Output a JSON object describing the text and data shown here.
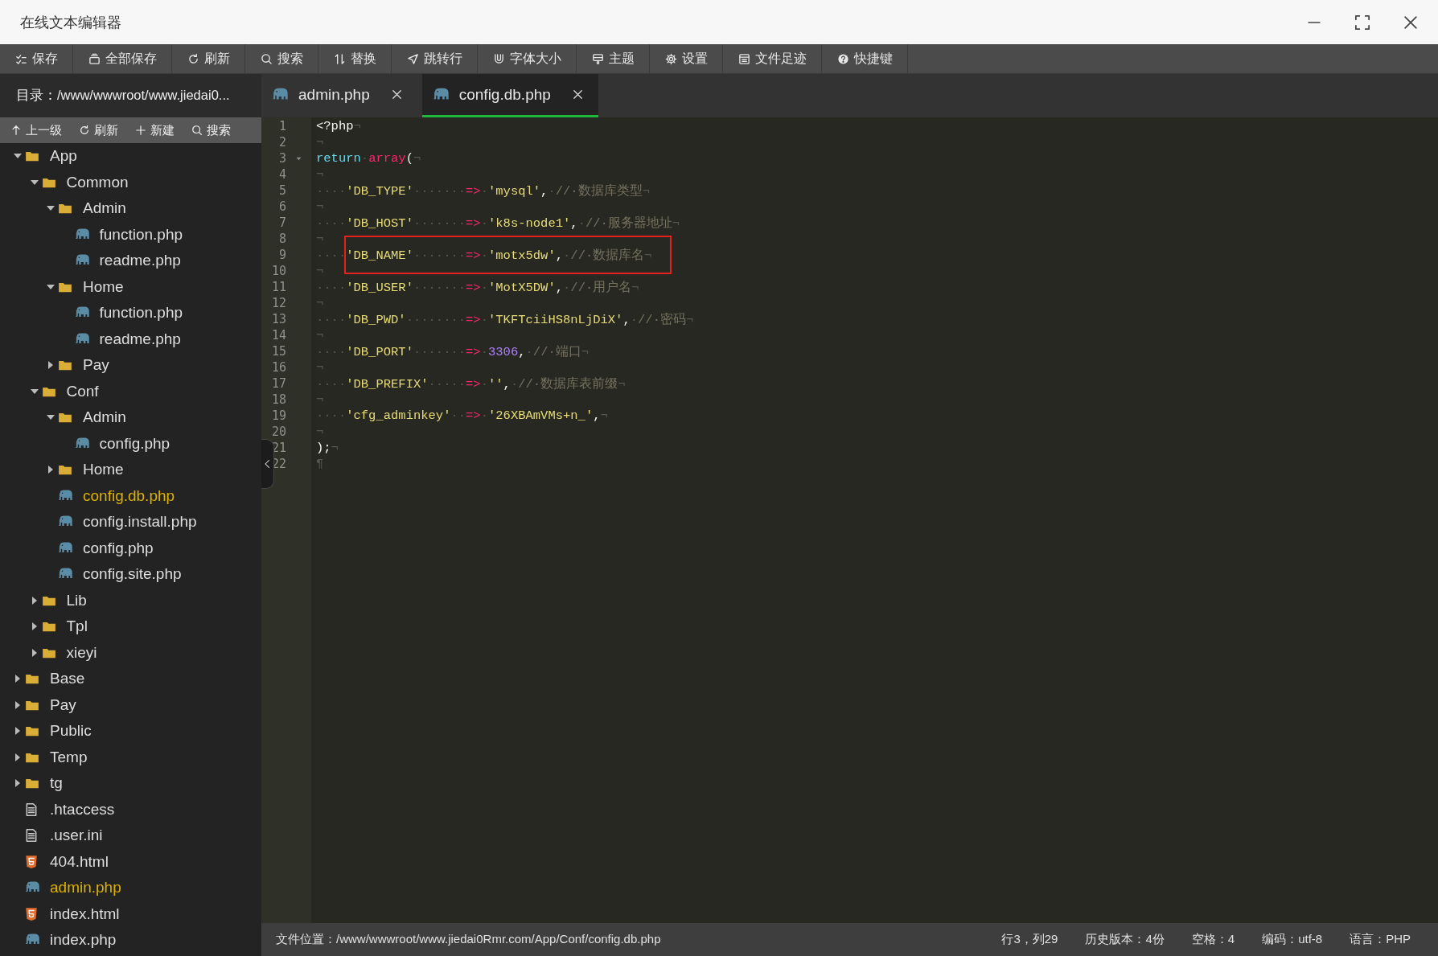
{
  "window": {
    "title": "在线文本编辑器"
  },
  "toolbar": [
    {
      "kind": "save",
      "label": "保存"
    },
    {
      "kind": "save-all",
      "label": "全部保存"
    },
    {
      "kind": "refresh",
      "label": "刷新"
    },
    {
      "kind": "search",
      "label": "搜索"
    },
    {
      "kind": "replace",
      "label": "替换"
    },
    {
      "kind": "goto",
      "label": "跳转行"
    },
    {
      "kind": "font",
      "label": "字体大小"
    },
    {
      "kind": "theme",
      "label": "主题"
    },
    {
      "kind": "settings",
      "label": "设置"
    },
    {
      "kind": "history",
      "label": "文件足迹"
    },
    {
      "kind": "shortcuts",
      "label": "快捷键"
    }
  ],
  "sidebar": {
    "directory": "目录：/www/wwwroot/www.jiedai0...",
    "actions": [
      {
        "kind": "up",
        "label": "上一级"
      },
      {
        "kind": "refresh",
        "label": "刷新"
      },
      {
        "kind": "new",
        "label": "新建"
      },
      {
        "kind": "search",
        "label": "搜索"
      }
    ],
    "tree": [
      {
        "name": "App",
        "kind": "folder",
        "expanded": true,
        "children": [
          {
            "name": "Common",
            "kind": "folder",
            "expanded": true,
            "children": [
              {
                "name": "Admin",
                "kind": "folder",
                "expanded": true,
                "children": [
                  {
                    "name": "function.php",
                    "kind": "php",
                    "open": false
                  },
                  {
                    "name": "readme.php",
                    "kind": "php",
                    "open": false
                  }
                ]
              },
              {
                "name": "Home",
                "kind": "folder",
                "expanded": true,
                "children": [
                  {
                    "name": "function.php",
                    "kind": "php",
                    "open": false
                  },
                  {
                    "name": "readme.php",
                    "kind": "php",
                    "open": false
                  }
                ]
              },
              {
                "name": "Pay",
                "kind": "folder",
                "expanded": false
              }
            ]
          },
          {
            "name": "Conf",
            "kind": "folder",
            "expanded": true,
            "children": [
              {
                "name": "Admin",
                "kind": "folder",
                "expanded": true,
                "children": [
                  {
                    "name": "config.php",
                    "kind": "php",
                    "open": false
                  }
                ]
              },
              {
                "name": "Home",
                "kind": "folder",
                "expanded": false
              },
              {
                "name": "config.db.php",
                "kind": "php",
                "open": true
              },
              {
                "name": "config.install.php",
                "kind": "php",
                "open": false
              },
              {
                "name": "config.php",
                "kind": "php",
                "open": false
              },
              {
                "name": "config.site.php",
                "kind": "php",
                "open": false
              }
            ]
          },
          {
            "name": "Lib",
            "kind": "folder",
            "expanded": false
          },
          {
            "name": "Tpl",
            "kind": "folder",
            "expanded": false
          },
          {
            "name": "xieyi",
            "kind": "folder",
            "expanded": false
          }
        ]
      },
      {
        "name": "Base",
        "kind": "folder",
        "expanded": false
      },
      {
        "name": "Pay",
        "kind": "folder",
        "expanded": false
      },
      {
        "name": "Public",
        "kind": "folder",
        "expanded": false
      },
      {
        "name": "Temp",
        "kind": "folder",
        "expanded": false
      },
      {
        "name": "tg",
        "kind": "folder",
        "expanded": false
      },
      {
        "name": ".htaccess",
        "kind": "text",
        "open": false
      },
      {
        "name": ".user.ini",
        "kind": "text",
        "open": false
      },
      {
        "name": "404.html",
        "kind": "html",
        "open": false
      },
      {
        "name": "admin.php",
        "kind": "php",
        "open": true
      },
      {
        "name": "index.html",
        "kind": "html",
        "open": false
      },
      {
        "name": "index.php",
        "kind": "php",
        "open": false
      }
    ]
  },
  "tabs": [
    {
      "label": "admin.php",
      "selected": false
    },
    {
      "label": "config.db.php",
      "selected": true
    }
  ],
  "editor": {
    "lines": [
      {
        "number": "1",
        "foldable": false,
        "boxed": false,
        "tokens": [
          {
            "kind": "plain",
            "text": "<?php"
          },
          {
            "kind": "ws",
            "text": "¬"
          }
        ]
      },
      {
        "number": "2",
        "foldable": false,
        "boxed": false,
        "tokens": [
          {
            "kind": "ws",
            "text": "¬"
          }
        ]
      },
      {
        "number": "3",
        "foldable": true,
        "boxed": false,
        "tokens": [
          {
            "kind": "kw",
            "text": "return"
          },
          {
            "kind": "ws",
            "text": "·"
          },
          {
            "kind": "fn",
            "text": "array"
          },
          {
            "kind": "plain",
            "text": "("
          },
          {
            "kind": "ws",
            "text": "¬"
          }
        ]
      },
      {
        "number": "4",
        "foldable": false,
        "boxed": false,
        "tokens": [
          {
            "kind": "ws",
            "text": "¬"
          }
        ]
      },
      {
        "number": "5",
        "foldable": false,
        "boxed": false,
        "tokens": [
          {
            "kind": "ws",
            "text": "····"
          },
          {
            "kind": "str",
            "text": "'DB_TYPE'"
          },
          {
            "kind": "ws",
            "text": "·······"
          },
          {
            "kind": "op",
            "text": "=>"
          },
          {
            "kind": "ws",
            "text": "·"
          },
          {
            "kind": "str",
            "text": "'mysql'"
          },
          {
            "kind": "plain",
            "text": ","
          },
          {
            "kind": "ws",
            "text": "·"
          },
          {
            "kind": "com",
            "text": "//·数据库类型"
          },
          {
            "kind": "ws",
            "text": "¬"
          }
        ]
      },
      {
        "number": "6",
        "foldable": false,
        "boxed": false,
        "tokens": [
          {
            "kind": "ws",
            "text": "¬"
          }
        ]
      },
      {
        "number": "7",
        "foldable": false,
        "boxed": false,
        "tokens": [
          {
            "kind": "ws",
            "text": "····"
          },
          {
            "kind": "str",
            "text": "'DB_HOST'"
          },
          {
            "kind": "ws",
            "text": "·······"
          },
          {
            "kind": "op",
            "text": "=>"
          },
          {
            "kind": "ws",
            "text": "·"
          },
          {
            "kind": "str",
            "text": "'k8s-node1'"
          },
          {
            "kind": "plain",
            "text": ","
          },
          {
            "kind": "ws",
            "text": "·"
          },
          {
            "kind": "com",
            "text": "//·服务器地址"
          },
          {
            "kind": "ws",
            "text": "¬"
          }
        ]
      },
      {
        "number": "8",
        "foldable": false,
        "boxed": false,
        "tokens": [
          {
            "kind": "ws",
            "text": "¬"
          }
        ]
      },
      {
        "number": "9",
        "foldable": false,
        "boxed": true,
        "tokens": [
          {
            "kind": "ws",
            "text": "····"
          },
          {
            "kind": "str",
            "text": "'DB_NAME'"
          },
          {
            "kind": "ws",
            "text": "·······"
          },
          {
            "kind": "op",
            "text": "=>"
          },
          {
            "kind": "ws",
            "text": "·"
          },
          {
            "kind": "str",
            "text": "'motx5dw'"
          },
          {
            "kind": "plain",
            "text": ","
          },
          {
            "kind": "ws",
            "text": "·"
          },
          {
            "kind": "com",
            "text": "//·数据库名"
          },
          {
            "kind": "ws",
            "text": "¬"
          }
        ]
      },
      {
        "number": "10",
        "foldable": false,
        "boxed": false,
        "tokens": [
          {
            "kind": "ws",
            "text": "¬"
          }
        ]
      },
      {
        "number": "11",
        "foldable": false,
        "boxed": false,
        "tokens": [
          {
            "kind": "ws",
            "text": "····"
          },
          {
            "kind": "str",
            "text": "'DB_USER'"
          },
          {
            "kind": "ws",
            "text": "·······"
          },
          {
            "kind": "op",
            "text": "=>"
          },
          {
            "kind": "ws",
            "text": "·"
          },
          {
            "kind": "str",
            "text": "'MotX5DW'"
          },
          {
            "kind": "plain",
            "text": ","
          },
          {
            "kind": "ws",
            "text": "·"
          },
          {
            "kind": "com",
            "text": "//·用户名"
          },
          {
            "kind": "ws",
            "text": "¬"
          }
        ]
      },
      {
        "number": "12",
        "foldable": false,
        "boxed": false,
        "tokens": [
          {
            "kind": "ws",
            "text": "¬"
          }
        ]
      },
      {
        "number": "13",
        "foldable": false,
        "boxed": false,
        "tokens": [
          {
            "kind": "ws",
            "text": "····"
          },
          {
            "kind": "str",
            "text": "'DB_PWD'"
          },
          {
            "kind": "ws",
            "text": "········"
          },
          {
            "kind": "op",
            "text": "=>"
          },
          {
            "kind": "ws",
            "text": "·"
          },
          {
            "kind": "str",
            "text": "'TKFTciiHS8nLjDiX'"
          },
          {
            "kind": "plain",
            "text": ","
          },
          {
            "kind": "ws",
            "text": "·"
          },
          {
            "kind": "com",
            "text": "//·密码"
          },
          {
            "kind": "ws",
            "text": "¬"
          }
        ]
      },
      {
        "number": "14",
        "foldable": false,
        "boxed": false,
        "tokens": [
          {
            "kind": "ws",
            "text": "¬"
          }
        ]
      },
      {
        "number": "15",
        "foldable": false,
        "boxed": false,
        "tokens": [
          {
            "kind": "ws",
            "text": "····"
          },
          {
            "kind": "str",
            "text": "'DB_PORT'"
          },
          {
            "kind": "ws",
            "text": "·······"
          },
          {
            "kind": "op",
            "text": "=>"
          },
          {
            "kind": "ws",
            "text": "·"
          },
          {
            "kind": "num",
            "text": "3306"
          },
          {
            "kind": "plain",
            "text": ","
          },
          {
            "kind": "ws",
            "text": "·"
          },
          {
            "kind": "com",
            "text": "//·端口"
          },
          {
            "kind": "ws",
            "text": "¬"
          }
        ]
      },
      {
        "number": "16",
        "foldable": false,
        "boxed": false,
        "tokens": [
          {
            "kind": "ws",
            "text": "¬"
          }
        ]
      },
      {
        "number": "17",
        "foldable": false,
        "boxed": false,
        "tokens": [
          {
            "kind": "ws",
            "text": "····"
          },
          {
            "kind": "str",
            "text": "'DB_PREFIX'"
          },
          {
            "kind": "ws",
            "text": "·····"
          },
          {
            "kind": "op",
            "text": "=>"
          },
          {
            "kind": "ws",
            "text": "·"
          },
          {
            "kind": "str",
            "text": "''"
          },
          {
            "kind": "plain",
            "text": ","
          },
          {
            "kind": "ws",
            "text": "·"
          },
          {
            "kind": "com",
            "text": "//·数据库表前缀"
          },
          {
            "kind": "ws",
            "text": "¬"
          }
        ]
      },
      {
        "number": "18",
        "foldable": false,
        "boxed": false,
        "tokens": [
          {
            "kind": "ws",
            "text": "¬"
          }
        ]
      },
      {
        "number": "19",
        "foldable": false,
        "boxed": false,
        "tokens": [
          {
            "kind": "ws",
            "text": "····"
          },
          {
            "kind": "str",
            "text": "'cfg_adminkey'"
          },
          {
            "kind": "ws",
            "text": "··"
          },
          {
            "kind": "op",
            "text": "=>"
          },
          {
            "kind": "ws",
            "text": "·"
          },
          {
            "kind": "str",
            "text": "'26XBAmVMs+n_'"
          },
          {
            "kind": "plain",
            "text": ","
          },
          {
            "kind": "ws",
            "text": "¬"
          }
        ]
      },
      {
        "number": "20",
        "foldable": false,
        "boxed": false,
        "tokens": [
          {
            "kind": "ws",
            "text": "¬"
          }
        ]
      },
      {
        "number": "21",
        "foldable": false,
        "boxed": false,
        "tokens": [
          {
            "kind": "plain",
            "text": ");"
          },
          {
            "kind": "ws",
            "text": "¬"
          }
        ]
      },
      {
        "number": "22",
        "foldable": false,
        "boxed": false,
        "tokens": [
          {
            "kind": "ws",
            "text": "¶"
          }
        ]
      }
    ]
  },
  "status_bar": {
    "file_path": "文件位置：/www/wwwroot/www.jiedai0Rmr.com/App/Conf/config.db.php",
    "items": [
      "行3，列29",
      "历史版本：4份",
      "空格：4",
      "编码：utf-8",
      "语言：PHP"
    ]
  }
}
